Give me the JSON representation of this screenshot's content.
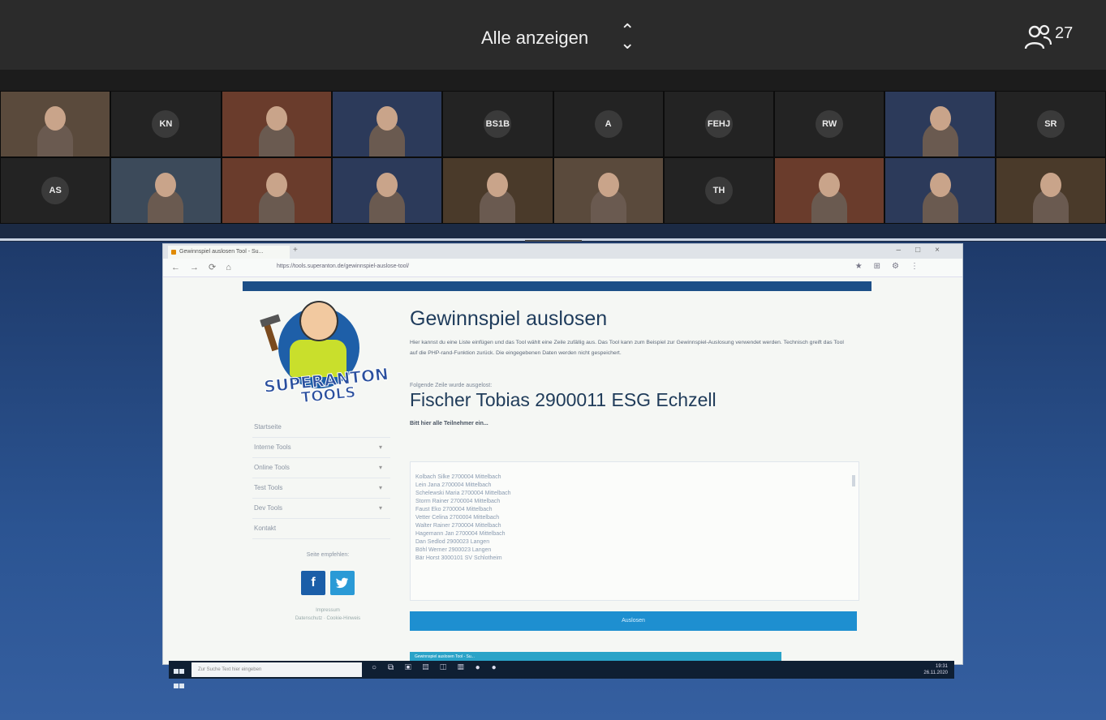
{
  "meeting": {
    "view_label": "Alle anzeigen",
    "participant_count": "27",
    "participants": [
      {
        "initials": "",
        "video": true
      },
      {
        "initials": "KN",
        "video": false
      },
      {
        "initials": "",
        "video": true
      },
      {
        "initials": "",
        "video": true
      },
      {
        "initials": "BS1B",
        "video": false
      },
      {
        "initials": "A",
        "video": false
      },
      {
        "initials": "FEHJ",
        "video": false
      },
      {
        "initials": "RW",
        "video": false
      },
      {
        "initials": "",
        "video": true
      },
      {
        "initials": "SR",
        "video": false
      },
      {
        "initials": "AS",
        "video": false
      },
      {
        "initials": "",
        "video": true
      },
      {
        "initials": "",
        "video": true
      },
      {
        "initials": "",
        "video": true
      },
      {
        "initials": "",
        "video": true
      },
      {
        "initials": "",
        "video": true
      },
      {
        "initials": "TH",
        "video": false
      },
      {
        "initials": "",
        "video": true
      },
      {
        "initials": "",
        "video": true
      },
      {
        "initials": "",
        "video": true
      }
    ]
  },
  "browser": {
    "tab_title": "Gewinnspiel auslosen Tool - Su...",
    "url": "https://tools.superanton.de/gewinnspiel-auslose-tool/"
  },
  "site": {
    "logo_line1": "SUPERANTON",
    "logo_line2": "TOOLS",
    "menu": [
      {
        "label": "Startseite",
        "has_sub": false
      },
      {
        "label": "Interne Tools",
        "has_sub": true
      },
      {
        "label": "Online Tools",
        "has_sub": true
      },
      {
        "label": "Test Tools",
        "has_sub": true
      },
      {
        "label": "Dev Tools",
        "has_sub": true
      },
      {
        "label": "Kontakt",
        "has_sub": false
      }
    ],
    "social_label": "Seite empfehlen:",
    "facebook": "f",
    "twitter": "t",
    "footer_line1": "Impressum",
    "footer_line2": "Datenschutz · Cookie-Hinweis"
  },
  "page": {
    "title": "Gewinnspiel auslosen",
    "intro": "Hier kannst du eine Liste einfügen und das Tool wählt eine Zeile zufällig aus. Das Tool kann zum Beispiel zur Gewinnspiel-Auslosung verwendet werden. Technisch greift das Tool auf die PHP-rand-Funktion zurück. Die eingegebenen Daten werden nicht gespeichert.",
    "drawn_label": "Folgende Zeile wurde ausgelost:",
    "winner": "Fischer Tobias 2900011 ESG Echzell",
    "list_hint": "Bitt hier alle Teilnehmer ein...",
    "entries": [
      "Kolbach   Silke      2700004 Mittelbach",
      "Lein      Jana       2700004 Mittelbach",
      "Schelewski   Maria      2700004 Mittelbach",
      "Storm     Rainer     2700004 Mittelbach",
      "Faust     Eko 2700004 Mittelbach",
      "Vetter    Celina     2700004 Mittelbach",
      "Walter    Rainer     2700004 Mittelbach",
      "Hagemann     Jan    2700004 Mittelbach",
      "Dan Sedlod    2900023 Langen",
      "Böhl      Werner   2900023 Langen",
      "Bär Horst     3000101 SV Schlotheim"
    ],
    "draw_button": "Auslosen"
  },
  "taskbar": {
    "search_placeholder": "Zur Suche Text hier eingeben",
    "time": "19:31",
    "date": "26.11.2020"
  },
  "colors": {
    "header_bg": "#2b2b2b",
    "site_bar": "#1d4f87",
    "draw_button": "#1e8fd0"
  }
}
